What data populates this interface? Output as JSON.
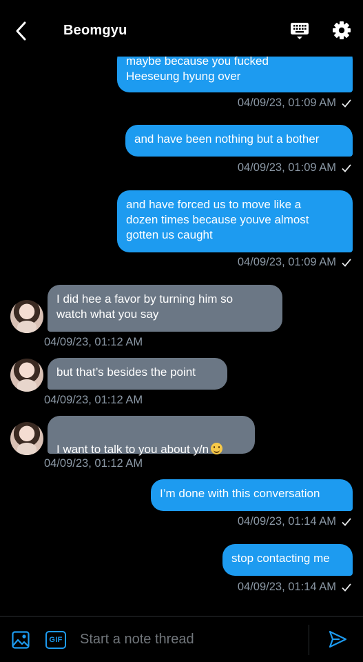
{
  "header": {
    "title": "Beomgyu",
    "back_icon": "chevron-left-icon",
    "keyboard_icon": "keyboard-icon",
    "settings_icon": "gear-icon"
  },
  "messages": [
    {
      "direction": "sent",
      "text": "maybe because you fucked\nHeeseung hyung over",
      "timestamp": "04/09/23, 01:09 AM",
      "read": true
    },
    {
      "direction": "sent",
      "text": "and have been nothing but a bother",
      "timestamp": "04/09/23, 01:09 AM",
      "read": true
    },
    {
      "direction": "sent",
      "text": "and have forced us to move like a\ndozen times because youve almost\ngotten us caught",
      "timestamp": "04/09/23, 01:09 AM",
      "read": true
    },
    {
      "direction": "received",
      "text": "I did hee a favor by turning him so\nwatch what you say",
      "timestamp": "04/09/23, 01:12 AM"
    },
    {
      "direction": "received",
      "text": "but that’s besides the point",
      "timestamp": "04/09/23, 01:12 AM"
    },
    {
      "direction": "received",
      "text": "I want to talk to you about y/n",
      "emoji": "smiling-face-emoji",
      "timestamp": "04/09/23, 01:12 AM"
    },
    {
      "direction": "sent",
      "text": "I’m done with this conversation",
      "timestamp": "04/09/23, 01:14 AM",
      "read": true
    },
    {
      "direction": "sent",
      "text": "stop contacting me",
      "timestamp": "04/09/23, 01:14 AM",
      "read": true
    }
  ],
  "composer": {
    "placeholder": "Start a note thread",
    "gif_label": "GIF",
    "image_icon": "image-icon",
    "send_icon": "send-icon"
  },
  "colors": {
    "sent_bubble": "#1d9bf0",
    "received_bubble": "#6b7785",
    "timestamp": "#8b98a5",
    "background": "#000000"
  }
}
